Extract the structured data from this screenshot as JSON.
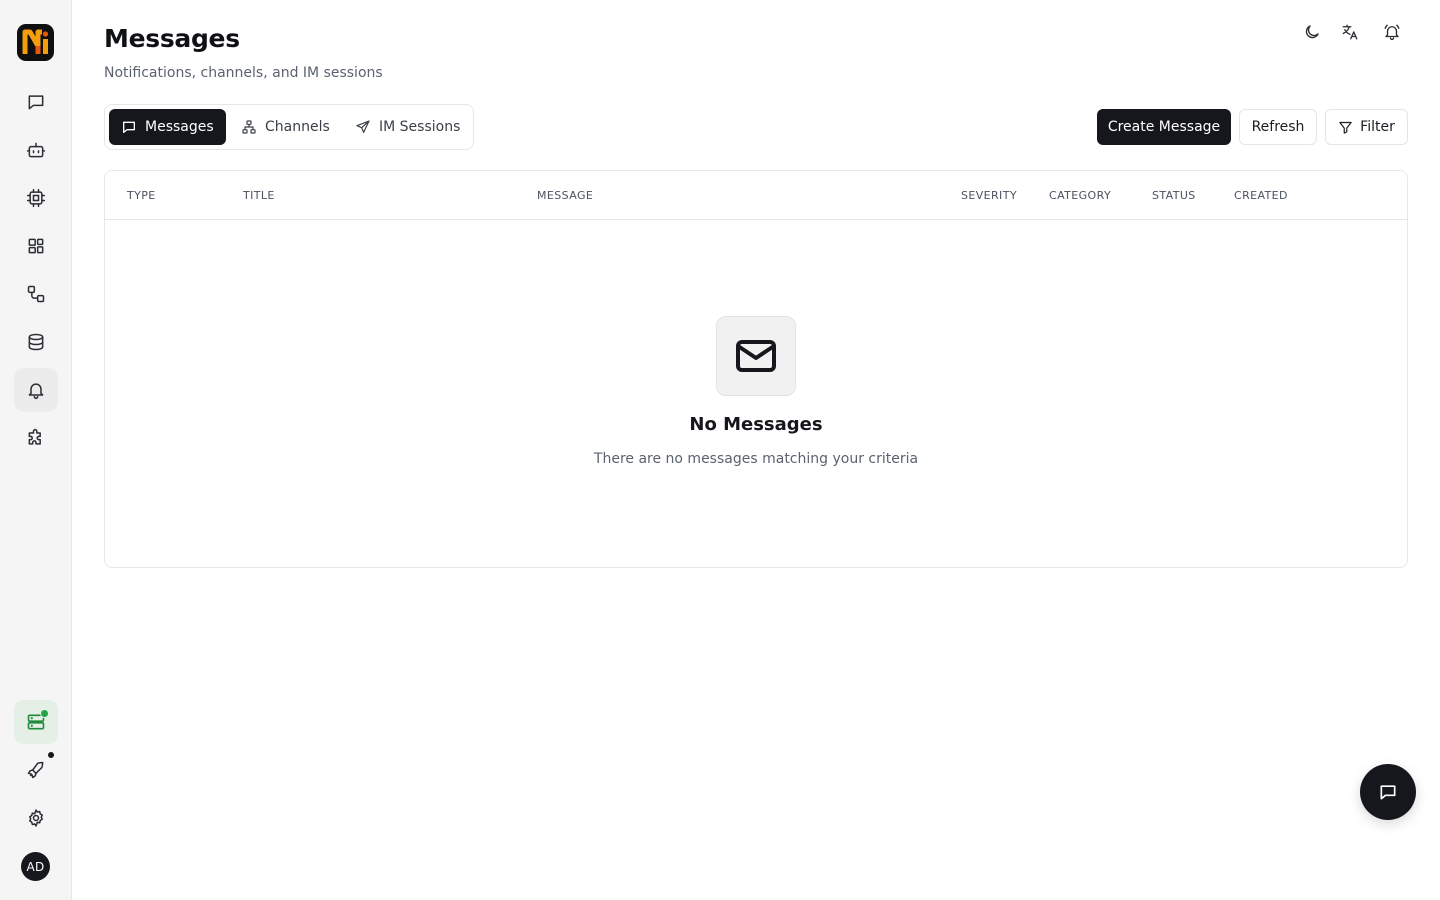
{
  "app": {
    "logo_text": "N",
    "logo_colors": {
      "primary": "#f59e0b",
      "secondary": "#ea580c",
      "background": "#0f0f10"
    }
  },
  "sidebar": {
    "items": [
      {
        "name": "chat",
        "icon": "message-square-icon",
        "active": false
      },
      {
        "name": "agents",
        "icon": "bot-icon",
        "active": false
      },
      {
        "name": "models",
        "icon": "cpu-icon",
        "active": false
      },
      {
        "name": "apps",
        "icon": "layout-grid-icon",
        "active": false
      },
      {
        "name": "workflows",
        "icon": "workflow-icon",
        "active": false
      },
      {
        "name": "knowledge",
        "icon": "database-icon",
        "active": false
      },
      {
        "name": "messages",
        "icon": "bell-icon",
        "active": true
      },
      {
        "name": "plugins",
        "icon": "puzzle-icon",
        "active": false
      }
    ],
    "bottom": [
      {
        "name": "server-status",
        "icon": "server-icon",
        "status_color": "#22a447"
      },
      {
        "name": "launch",
        "icon": "rocket-icon"
      },
      {
        "name": "settings",
        "icon": "gear-icon"
      }
    ],
    "avatar_initials": "AD"
  },
  "header": {
    "title": "Messages",
    "subtitle": "Notifications, channels, and IM sessions",
    "icons": [
      "moon-icon",
      "translate-icon",
      "bell-icon"
    ]
  },
  "tabs": [
    {
      "label": "Messages",
      "icon": "message-square-icon",
      "active": true
    },
    {
      "label": "Channels",
      "icon": "network-icon",
      "active": false
    },
    {
      "label": "IM Sessions",
      "icon": "send-icon",
      "active": false
    }
  ],
  "actions": {
    "create": "Create Message",
    "refresh": "Refresh",
    "filter": "Filter"
  },
  "table": {
    "columns": [
      "TYPE",
      "TITLE",
      "MESSAGE",
      "SEVERITY",
      "CATEGORY",
      "STATUS",
      "CREATED"
    ],
    "rows": []
  },
  "empty_state": {
    "icon": "mail-icon",
    "title": "No Messages",
    "text": "There are no messages matching your criteria"
  },
  "colors": {
    "primary": "#15171c",
    "accent_green": "#1f8a3a"
  }
}
